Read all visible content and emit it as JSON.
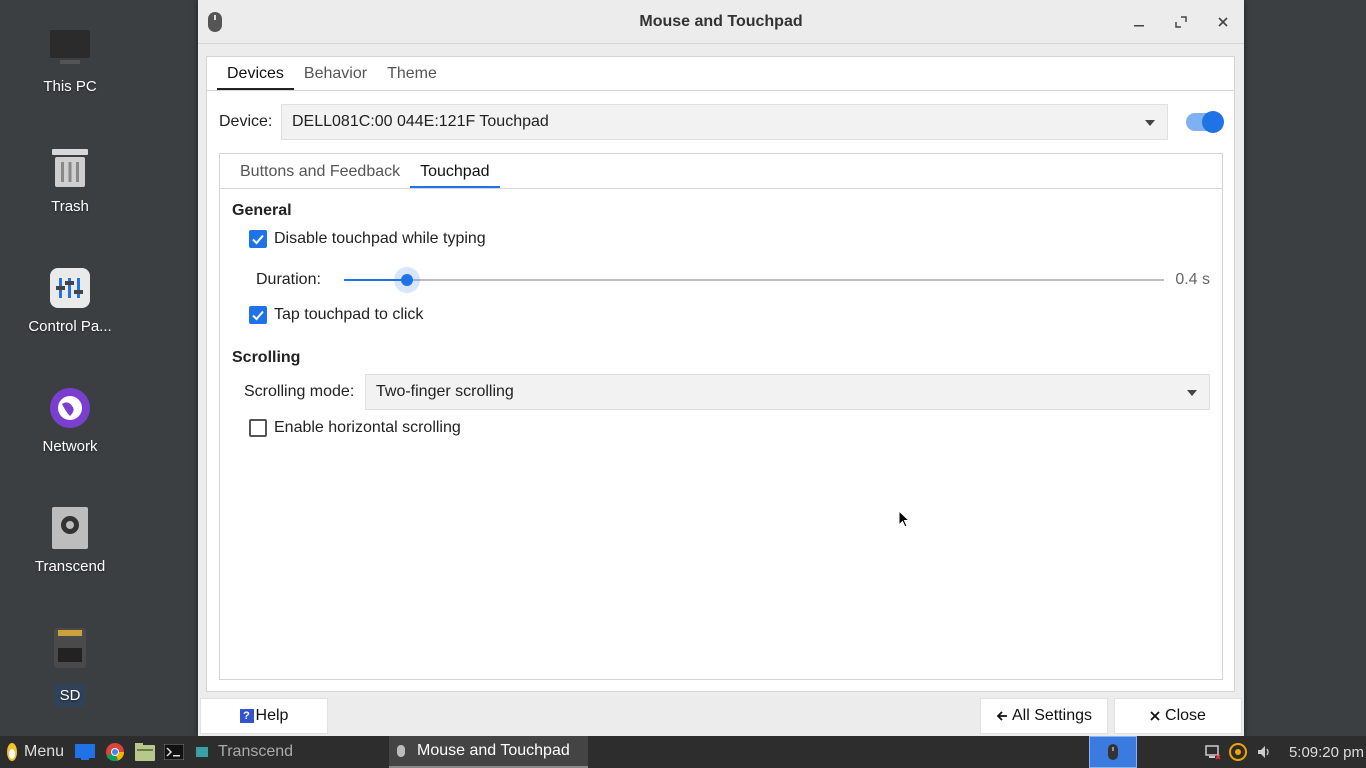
{
  "desktop": {
    "icons": [
      {
        "label": "This PC"
      },
      {
        "label": "Trash"
      },
      {
        "label": "Control Pa..."
      },
      {
        "label": "Network"
      },
      {
        "label": "Transcend"
      },
      {
        "label": "SD"
      }
    ]
  },
  "window": {
    "title": "Mouse and Touchpad",
    "top_tabs": [
      "Devices",
      "Behavior",
      "Theme"
    ],
    "active_top_tab": "Devices",
    "device": {
      "label": "Device:",
      "value": "DELL081C:00 044E:121F Touchpad",
      "enabled": true
    },
    "inner_tabs": [
      "Buttons and Feedback",
      "Touchpad"
    ],
    "active_inner_tab": "Touchpad",
    "general": {
      "title": "General",
      "disable_while_typing": {
        "label": "Disable touchpad while typing",
        "checked": true
      },
      "duration": {
        "label": "Duration:",
        "value_text": "0.4 s",
        "value": 0.4,
        "fraction": 0.077
      },
      "tap_to_click": {
        "label": "Tap touchpad to click",
        "checked": true
      }
    },
    "scrolling": {
      "title": "Scrolling",
      "mode_label": "Scrolling mode:",
      "mode_value": "Two-finger scrolling",
      "horizontal": {
        "label": "Enable horizontal scrolling",
        "checked": false
      }
    },
    "buttons": {
      "help": "Help",
      "all_settings": "All Settings",
      "close": "Close"
    }
  },
  "taskbar": {
    "menu_label": "Menu",
    "tasks": [
      {
        "label": "Transcend",
        "active": false
      },
      {
        "label": "Mouse and Touchpad",
        "active": true
      }
    ],
    "clock": "5:09:20 pm"
  },
  "colors": {
    "accent": "#1f73e6",
    "desktop_bg": "#3c3f41",
    "taskbar_bg": "#2d2d2d"
  }
}
